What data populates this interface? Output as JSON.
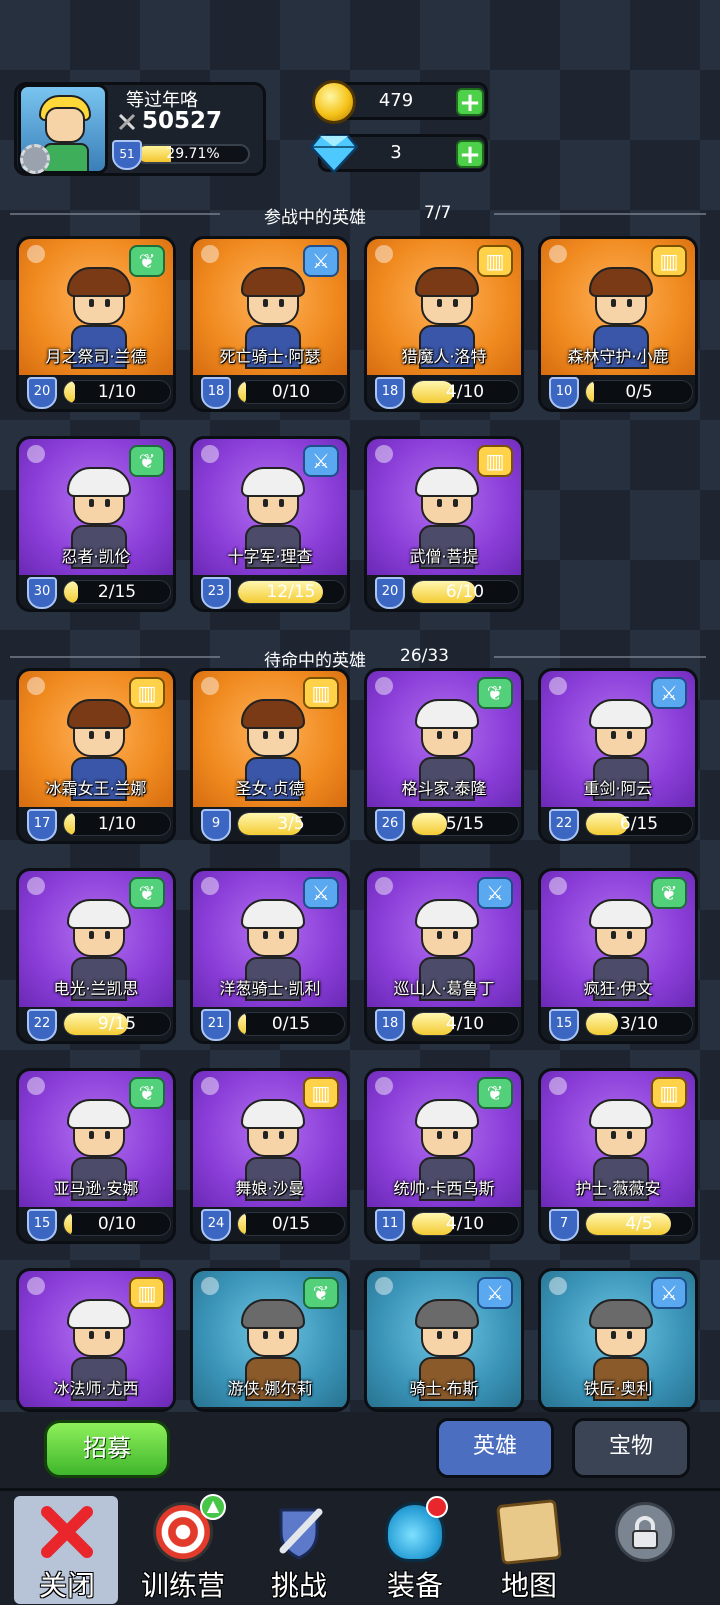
{
  "player": {
    "name": "等过年咯",
    "power": "50527",
    "level": "51",
    "xp_percent_text": "29.71%",
    "xp_fraction": 0.2971
  },
  "currency": {
    "gold": "479",
    "gems": "3",
    "add_symbol": "+"
  },
  "sections": {
    "active_title": "参战中的英雄",
    "active_count": "7/7",
    "standby_title": "待命中的英雄",
    "standby_count": "26/33"
  },
  "active_heroes": [
    {
      "name": "月之祭司·兰德",
      "level": "20",
      "progress": "1/10",
      "fraction": 0.1,
      "color": "orange",
      "badge": "wing-icon"
    },
    {
      "name": "死亡骑士·阿瑟",
      "level": "18",
      "progress": "0/10",
      "fraction": 0.0,
      "color": "orange",
      "badge": "sword-icon"
    },
    {
      "name": "猎魔人·洛特",
      "level": "18",
      "progress": "4/10",
      "fraction": 0.4,
      "color": "orange",
      "badge": "book-icon"
    },
    {
      "name": "森林守护·小鹿",
      "level": "10",
      "progress": "0/5",
      "fraction": 0.0,
      "color": "orange",
      "badge": "book-icon"
    },
    {
      "name": "忍者·凯伦",
      "level": "30",
      "progress": "2/15",
      "fraction": 0.13,
      "color": "purple",
      "badge": "wing-icon"
    },
    {
      "name": "十字军·理查",
      "level": "23",
      "progress": "12/15",
      "fraction": 0.8,
      "color": "purple",
      "badge": "sword-icon"
    },
    {
      "name": "武僧·菩提",
      "level": "20",
      "progress": "6/10",
      "fraction": 0.6,
      "color": "purple",
      "badge": "book-icon"
    }
  ],
  "standby_heroes": [
    {
      "name": "冰霜女王·兰娜",
      "level": "17",
      "progress": "1/10",
      "fraction": 0.1,
      "color": "orange",
      "badge": "book-icon"
    },
    {
      "name": "圣女·贞德",
      "level": "9",
      "progress": "3/5",
      "fraction": 0.6,
      "color": "orange",
      "badge": "book-icon"
    },
    {
      "name": "格斗家·泰隆",
      "level": "26",
      "progress": "5/15",
      "fraction": 0.33,
      "color": "purple",
      "badge": "wing-icon"
    },
    {
      "name": "重剑·阿云",
      "level": "22",
      "progress": "6/15",
      "fraction": 0.4,
      "color": "purple",
      "badge": "sword-icon"
    },
    {
      "name": "电光·兰凯思",
      "level": "22",
      "progress": "9/15",
      "fraction": 0.6,
      "color": "purple",
      "badge": "wing-icon"
    },
    {
      "name": "洋葱骑士·凯利",
      "level": "21",
      "progress": "0/15",
      "fraction": 0.0,
      "color": "purple",
      "badge": "sword-icon"
    },
    {
      "name": "巡山人·葛鲁丁",
      "level": "18",
      "progress": "4/10",
      "fraction": 0.4,
      "color": "purple",
      "badge": "sword-icon"
    },
    {
      "name": "疯狂·伊文",
      "level": "15",
      "progress": "3/10",
      "fraction": 0.3,
      "color": "purple",
      "badge": "wing-icon"
    },
    {
      "name": "亚马逊·安娜",
      "level": "15",
      "progress": "0/10",
      "fraction": 0.0,
      "color": "purple",
      "badge": "wing-icon"
    },
    {
      "name": "舞娘·沙曼",
      "level": "24",
      "progress": "0/15",
      "fraction": 0.0,
      "color": "purple",
      "badge": "book-icon"
    },
    {
      "name": "统帅·卡西乌斯",
      "level": "11",
      "progress": "4/10",
      "fraction": 0.4,
      "color": "purple",
      "badge": "wing-icon"
    },
    {
      "name": "护士·薇薇安",
      "level": "7",
      "progress": "4/5",
      "fraction": 0.8,
      "color": "purple",
      "badge": "book-icon"
    },
    {
      "name": "冰法师·尤西",
      "level": "",
      "progress": "",
      "fraction": 0.0,
      "color": "purple",
      "badge": "book-icon"
    },
    {
      "name": "游侠·娜尔莉",
      "level": "",
      "progress": "",
      "fraction": 0.0,
      "color": "blue",
      "badge": "wing-icon"
    },
    {
      "name": "骑士·布斯",
      "level": "",
      "progress": "",
      "fraction": 0.0,
      "color": "blue",
      "badge": "sword-icon"
    },
    {
      "name": "铁匠·奥利",
      "level": "",
      "progress": "",
      "fraction": 0.0,
      "color": "blue",
      "badge": "sword-icon"
    }
  ],
  "actions": {
    "recruit_label": "招募",
    "tab_heroes": "英雄",
    "tab_treasure": "宝物"
  },
  "nav": {
    "close": "关闭",
    "training": "训练营",
    "challenge": "挑战",
    "equipment": "装备",
    "map": "地图"
  },
  "colors": {
    "orange_card": "#f08a1f",
    "purple_card": "#8a3ed8",
    "blue_card": "#3a94b8",
    "progress_fill": "#f4cc34",
    "plus_green": "#4dd14a",
    "active_tab": "#4b6ec0"
  }
}
